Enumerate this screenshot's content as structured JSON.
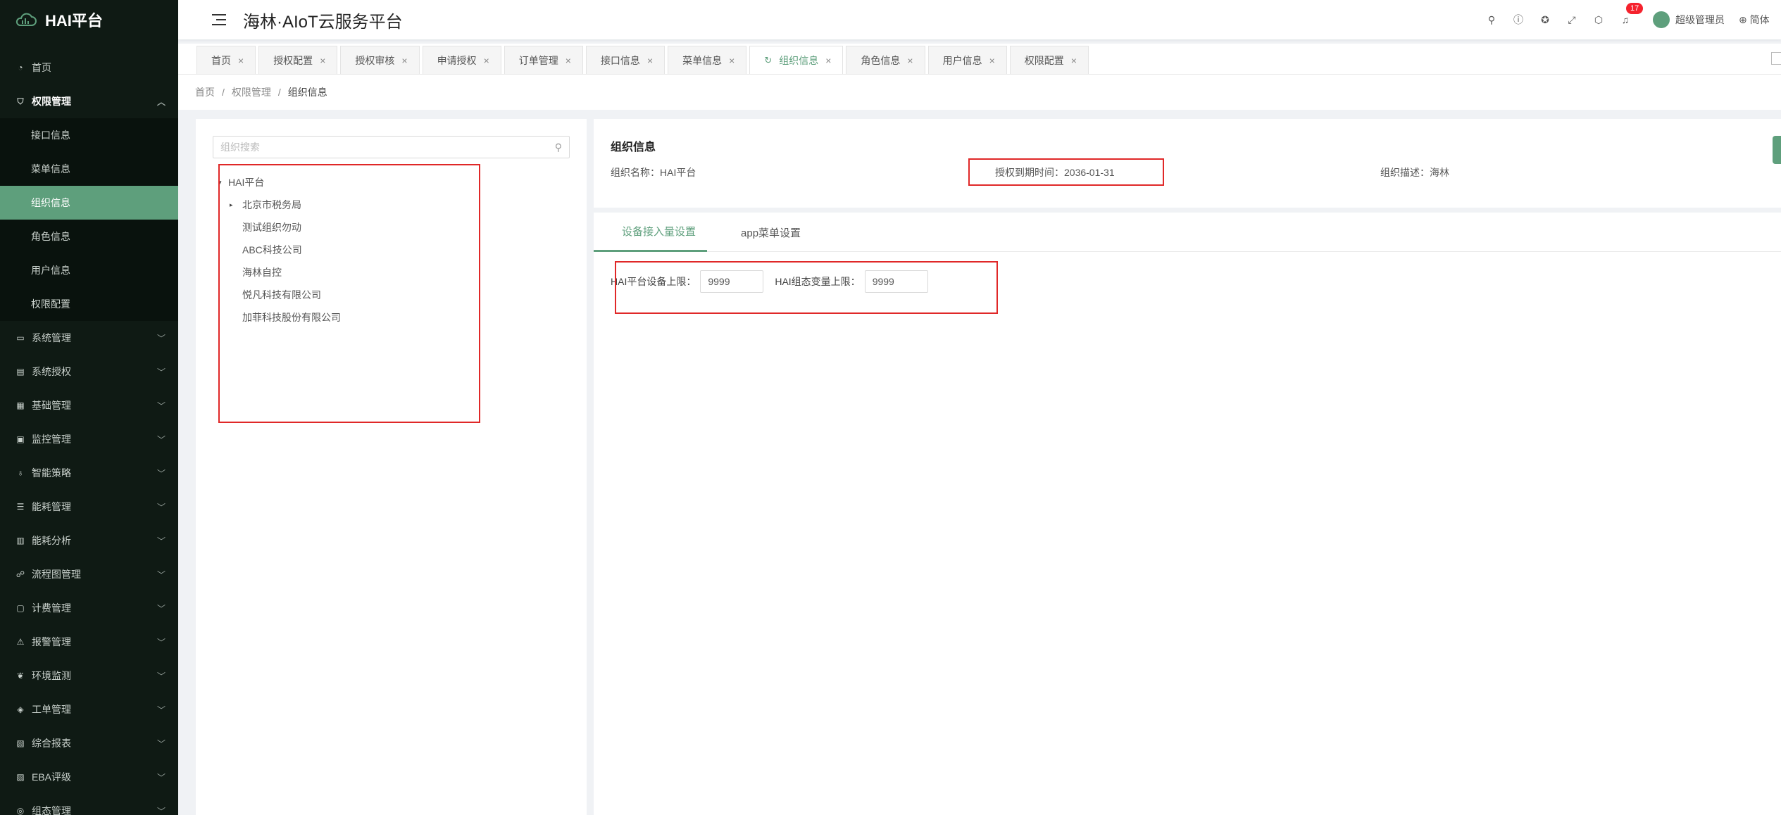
{
  "app": {
    "logo_text": "HAI平台",
    "title": "海林·AIoT云服务平台",
    "notification_count": "17",
    "username": "超级管理员",
    "language": "简体"
  },
  "sidebar": {
    "items": [
      {
        "label": "首页",
        "icon": "dashboard-icon"
      },
      {
        "label": "权限管理",
        "icon": "shield-icon",
        "open": true
      },
      {
        "label": "系统管理",
        "icon": "monitor-icon"
      },
      {
        "label": "系统授权",
        "icon": "document-icon"
      },
      {
        "label": "基础管理",
        "icon": "grid-icon"
      },
      {
        "label": "监控管理",
        "icon": "camera-icon"
      },
      {
        "label": "智能策略",
        "icon": "bulb-icon"
      },
      {
        "label": "能耗管理",
        "icon": "sliders-icon"
      },
      {
        "label": "能耗分析",
        "icon": "bar-chart-icon"
      },
      {
        "label": "流程图管理",
        "icon": "flow-icon"
      },
      {
        "label": "计费管理",
        "icon": "wallet-icon"
      },
      {
        "label": "报警管理",
        "icon": "alarm-icon"
      },
      {
        "label": "环境监测",
        "icon": "leaf-icon"
      },
      {
        "label": "工单管理",
        "icon": "layers-icon"
      },
      {
        "label": "综合报表",
        "icon": "report-icon"
      },
      {
        "label": "EBA评级",
        "icon": "badge-icon"
      },
      {
        "label": "组态管理",
        "icon": "config-icon"
      }
    ],
    "submenu": [
      "接口信息",
      "菜单信息",
      "组织信息",
      "角色信息",
      "用户信息",
      "权限配置"
    ],
    "active_sub": "组织信息"
  },
  "tabs": [
    {
      "label": "首页"
    },
    {
      "label": "授权配置"
    },
    {
      "label": "授权审核"
    },
    {
      "label": "申请授权"
    },
    {
      "label": "订单管理"
    },
    {
      "label": "接口信息"
    },
    {
      "label": "菜单信息"
    },
    {
      "label": "组织信息",
      "active": true
    },
    {
      "label": "角色信息"
    },
    {
      "label": "用户信息"
    },
    {
      "label": "权限配置"
    }
  ],
  "breadcrumb": [
    "首页",
    "权限管理",
    "组织信息"
  ],
  "tree": {
    "search_placeholder": "组织搜索",
    "root": "HAI平台",
    "children": [
      "北京市税务局",
      "测试组织勿动",
      "ABC科技公司",
      "海林自控",
      "悦凡科技有限公司",
      "加菲科技股份有限公司"
    ]
  },
  "org_info": {
    "title": "组织信息",
    "name_label": "组织名称：",
    "name_value": "HAI平台",
    "expire_label": "授权到期时间：",
    "expire_value": "2036-01-31",
    "desc_label": "组织描述：",
    "desc_value": "海林"
  },
  "config": {
    "tabs": [
      "设备接入量设置",
      "app菜单设置"
    ],
    "device_limit_label": "HAI平台设备上限：",
    "device_limit_value": "9999",
    "variable_limit_label": "HAI组态变量上限：",
    "variable_limit_value": "9999"
  },
  "colors": {
    "accent": "#5e9f7c",
    "sidebar_bg": "#0f1a14",
    "highlight_box": "#e02828"
  }
}
